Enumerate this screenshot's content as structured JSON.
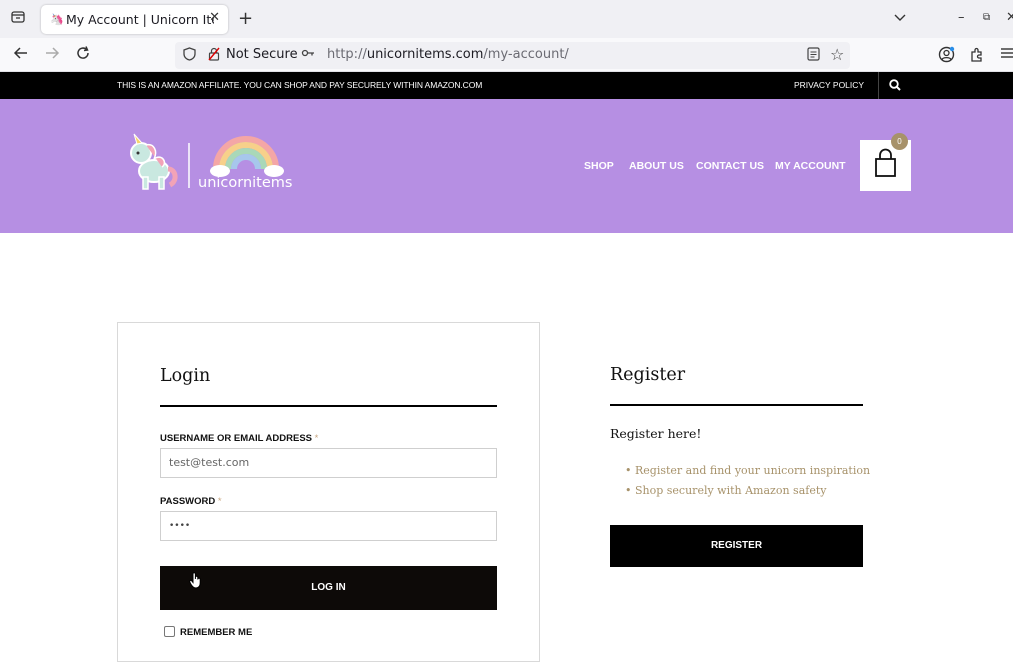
{
  "browser": {
    "tab_title": "My Account | Unicorn Items",
    "tab_close": "✕",
    "new_tab": "+",
    "not_secure": "Not Secure",
    "url_prefix": "http://",
    "url_domain": "unicornitems.com",
    "url_path": "/my-account/"
  },
  "topbar": {
    "notice": "THIS IS AN AMAZON AFFILIATE. YOU CAN SHOP AND PAY SECURELY WITHIN AMAZON.COM",
    "privacy": "PRIVACY POLICY"
  },
  "header": {
    "logo_text": "unicornitems",
    "menu": [
      "SHOP",
      "ABOUT US",
      "CONTACT US",
      "MY ACCOUNT"
    ],
    "cart_count": "0",
    "brand_color": "#b68fe3"
  },
  "login": {
    "title": "Login",
    "username_label": "USERNAME OR EMAIL ADDRESS",
    "required_mark": "*",
    "username_value": "test@test.com",
    "password_label": "PASSWORD",
    "password_value": "••••",
    "login_button": "LOG IN",
    "remember_me": "REMEMBER ME"
  },
  "register": {
    "title": "Register",
    "subtitle": "Register here!",
    "bullets": [
      "Register and find your unicorn inspiration",
      "Shop securely with Amazon safety"
    ],
    "button": "REGISTER"
  }
}
